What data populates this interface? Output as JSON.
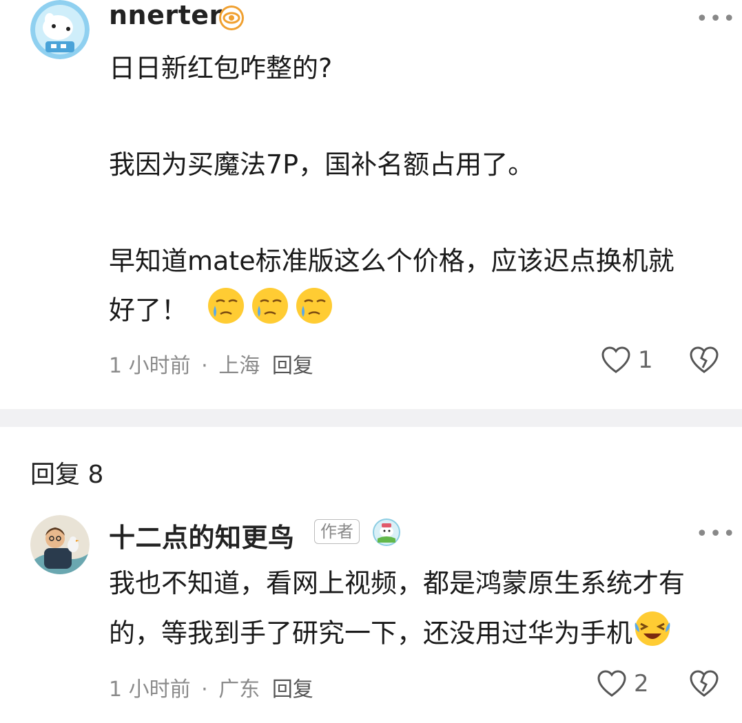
{
  "comment1": {
    "username": "nnerter",
    "badge_icon": "eye-icon",
    "lines": [
      "日日新红包咋整的?",
      "我因为买魔法7P，国补名额占用了。",
      "早知道mate标准版这么个价格，应该迟点换机就",
      "好了！"
    ],
    "emoji": "crying-face-emoji",
    "time": "1 小时前",
    "separator": "·",
    "location": "上海",
    "reply_label": "回复",
    "like_count": "1"
  },
  "replies_header": "回复 8",
  "comment2": {
    "username": "十二点的知更鸟",
    "author_badge": "作者",
    "lines": [
      "我也不知道，看网上视频，都是鸿蒙原生系统才有",
      "的，等我到手了研究一下，还没用过华为手机"
    ],
    "emoji": "laughing-crying-face-emoji",
    "time": "1 小时前",
    "separator": "·",
    "location": "广东",
    "reply_label": "回复",
    "like_count": "2"
  },
  "colors": {
    "divider": "#f1f1f3",
    "meta_text": "#8a8a8a",
    "badge_orange": "#f0a030"
  }
}
